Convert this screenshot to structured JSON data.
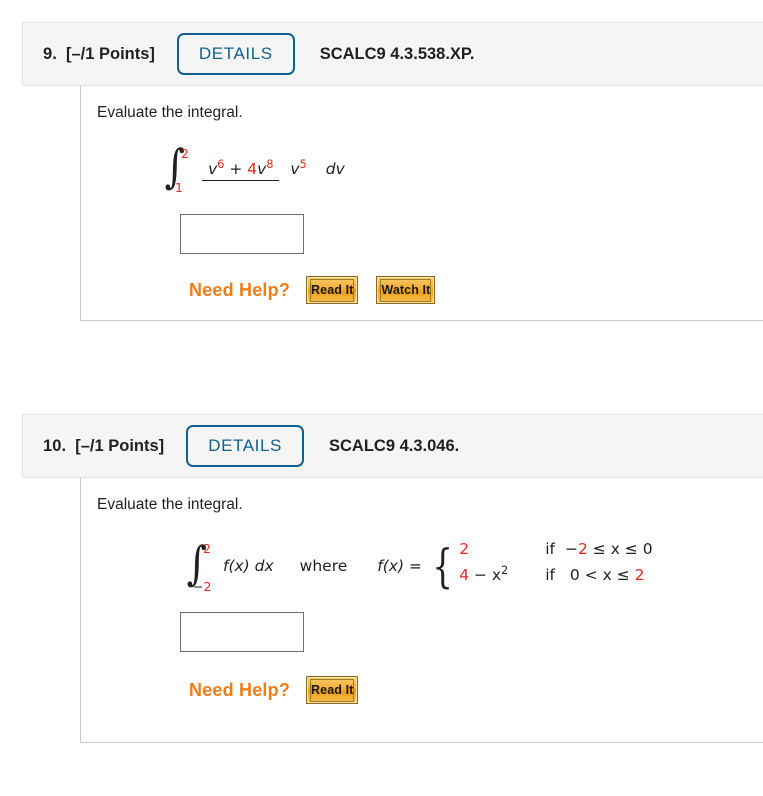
{
  "questions": [
    {
      "number": "9.",
      "points": "[–/1 Points]",
      "details_label": "DETAILS",
      "code": "SCALC9 4.3.538.XP.",
      "prompt": "Evaluate the integral.",
      "integral": {
        "lower_limit": "1",
        "upper_limit": "2",
        "numerator_base1": "v",
        "numerator_exp1": "6",
        "plus": "+",
        "numerator_coef": "4",
        "numerator_base2": "v",
        "numerator_exp2": "8",
        "denominator_base": "v",
        "denominator_exp": "5",
        "differential": "dv"
      },
      "answer_value": "",
      "need_help_label": "Need Help?",
      "help_buttons": [
        "Read It",
        "Watch It"
      ]
    },
    {
      "number": "10.",
      "points": "[–/1 Points]",
      "details_label": "DETAILS",
      "code": "SCALC9 4.3.046.",
      "prompt": "Evaluate the integral.",
      "integral": {
        "lower_limit_sign": "−",
        "lower_limit": "2",
        "upper_limit": "2",
        "integrand": "f(x) dx",
        "where": "where",
        "function_label": "f(x) =",
        "cases": [
          {
            "value": "2",
            "if": "if",
            "cond_lead_sign": "−",
            "cond_lead_num": "2",
            "cond_mid": "≤ x ≤",
            "cond_tail_num": "0"
          },
          {
            "value_num": "4",
            "value_rest": "− x",
            "value_exp": "2",
            "if": "if",
            "cond_lead_num": "0",
            "cond_mid": "< x ≤",
            "cond_tail_num": "2"
          }
        ]
      },
      "answer_value": "",
      "need_help_label": "Need Help?",
      "help_buttons": [
        "Read It"
      ]
    }
  ],
  "colors": {
    "accent_blue": "#10618f",
    "math_red": "#e8271c",
    "need_help_orange": "#f07d16",
    "header_bg": "#f5f5f5"
  }
}
